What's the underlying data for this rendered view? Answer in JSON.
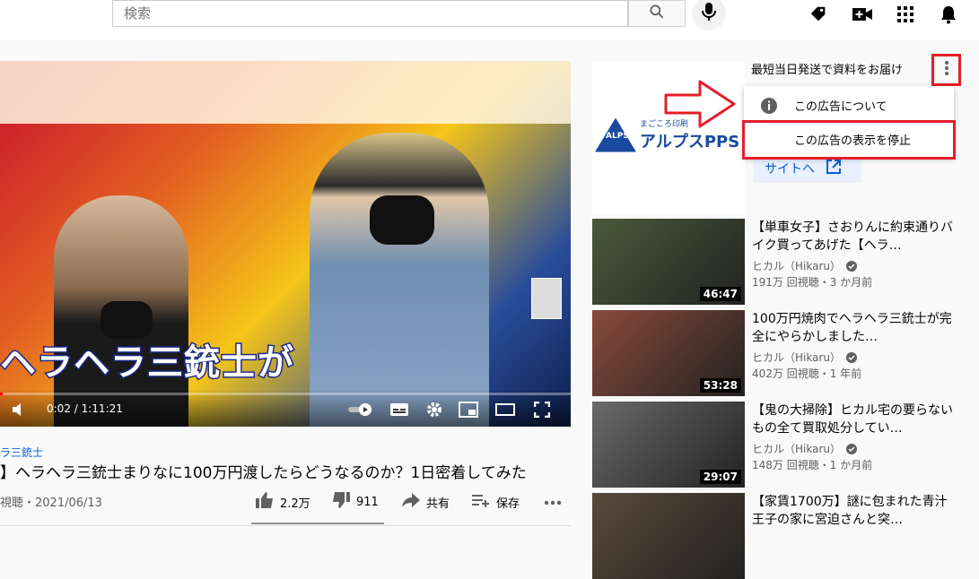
{
  "search": {
    "placeholder": "検索"
  },
  "player": {
    "time": "0:02 / 1:11:21",
    "progress_fraction": 0.0005,
    "caption": "ヘラヘラ三銃士が"
  },
  "video": {
    "channel": "ラ三銃士",
    "title": "】ヘラヘラ三銃士まりなに100万円渡したらどうなるのか？1日密着してみた",
    "info": "視聴・2021/06/13",
    "like_count": "2.2万",
    "dislike_count": "911",
    "share_label": "共有",
    "save_label": "保存"
  },
  "ad": {
    "headline": "最短当日発送で資料をお届け",
    "brand_small": "まごころ印刷",
    "brand": "アルプスPPS",
    "logo_text": "ALPS",
    "site_button": "サイトへ",
    "menu": {
      "about": "この広告について",
      "stop": "この広告の表示を停止"
    }
  },
  "recommendations": [
    {
      "title": "【単車女子】さおりんに約束通りバイク買ってあげた【ヘラ…",
      "channel": "ヒカル（Hikaru）",
      "meta": "191万 回視聴・3 か月前",
      "duration": "46:47",
      "color": "#4a5a3a"
    },
    {
      "title": "100万円焼肉でヘラヘラ三銃士が完全にやらかしました…",
      "channel": "ヒカル（Hikaru）",
      "meta": "402万 回視聴・1 年前",
      "duration": "53:28",
      "color": "#8a4a3a"
    },
    {
      "title": "【鬼の大掃除】ヒカル宅の要らないもの全て買取処分してい…",
      "channel": "ヒカル（Hikaru）",
      "meta": "148万 回視聴・1 か月前",
      "duration": "29:07",
      "color": "#6a6a6a"
    },
    {
      "title": "【家賃1700万】謎に包まれた青汁王子の家に宮迫さんと突…",
      "channel": "",
      "meta": "",
      "duration": "",
      "color": "#5a4a3a"
    }
  ]
}
